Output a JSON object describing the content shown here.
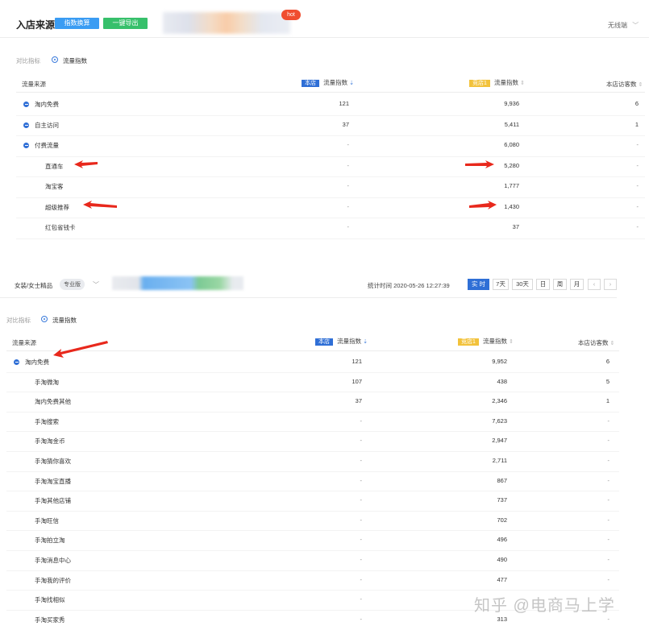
{
  "header": {
    "title": "入店来源",
    "index_button": "指数换算",
    "export_button": "一键导出",
    "hot_badge": "hot",
    "device_select": "无线端"
  },
  "panel1": {
    "compare_label": "对比指标",
    "compare_option": "流量指数",
    "col_source": "流量来源",
    "tag_own": "本店",
    "col_own": "流量指数",
    "tag_comp": "竞店1",
    "col_comp": "流量指数",
    "col_visitors": "本店访客数",
    "rows": [
      {
        "name": "淘内免费",
        "own": "121",
        "comp": "9,936",
        "visitors": "6"
      },
      {
        "name": "自主访问",
        "own": "37",
        "comp": "5,411",
        "visitors": "1"
      },
      {
        "name": "付费流量",
        "own": "-",
        "comp": "6,080",
        "visitors": "-"
      },
      {
        "name": "直通车",
        "own": "-",
        "comp": "5,280",
        "visitors": "-"
      },
      {
        "name": "淘宝客",
        "own": "-",
        "comp": "1,777",
        "visitors": "-"
      },
      {
        "name": "超级推荐",
        "own": "-",
        "comp": "1,430",
        "visitors": "-"
      },
      {
        "name": "红包省钱卡",
        "own": "-",
        "comp": "37",
        "visitors": "-"
      }
    ]
  },
  "toolbar2": {
    "category": "女装/女士精品",
    "edition": "专业版",
    "stat_time": "统计时间 2020-05-26 12:27:39",
    "periods": [
      "实 时",
      "7天",
      "30天",
      "日",
      "周",
      "月"
    ],
    "prev": "‹",
    "next": "›"
  },
  "panel2": {
    "compare_label": "对比指标",
    "compare_option": "流量指数",
    "col_source": "流量来源",
    "tag_own": "本店",
    "col_own": "流量指数",
    "tag_comp": "竞店1",
    "col_comp": "流量指数",
    "col_visitors": "本店访客数",
    "rows": [
      {
        "name": "淘内免费",
        "own": "121",
        "comp": "9,952",
        "visitors": "6"
      },
      {
        "name": "手淘微淘",
        "own": "107",
        "comp": "438",
        "visitors": "5"
      },
      {
        "name": "淘内免费其他",
        "own": "37",
        "comp": "2,346",
        "visitors": "1"
      },
      {
        "name": "手淘搜索",
        "own": "-",
        "comp": "7,623",
        "visitors": "-"
      },
      {
        "name": "手淘淘金币",
        "own": "-",
        "comp": "2,947",
        "visitors": "-"
      },
      {
        "name": "手淘猜你喜欢",
        "own": "-",
        "comp": "2,711",
        "visitors": "-"
      },
      {
        "name": "手淘淘宝直播",
        "own": "-",
        "comp": "867",
        "visitors": "-"
      },
      {
        "name": "手淘其他店铺",
        "own": "-",
        "comp": "737",
        "visitors": "-"
      },
      {
        "name": "手淘旺信",
        "own": "-",
        "comp": "702",
        "visitors": "-"
      },
      {
        "name": "手淘拍立淘",
        "own": "-",
        "comp": "496",
        "visitors": "-"
      },
      {
        "name": "手淘消息中心",
        "own": "-",
        "comp": "490",
        "visitors": "-"
      },
      {
        "name": "手淘我的评价",
        "own": "-",
        "comp": "477",
        "visitors": "-"
      },
      {
        "name": "手淘找相似",
        "own": "-",
        "comp": "",
        "visitors": "-"
      },
      {
        "name": "手淘买家秀",
        "own": "-",
        "comp": "313",
        "visitors": "-"
      }
    ]
  },
  "watermark": "知乎 @电商马上学",
  "colors": {
    "accent_blue": "#2f6fd6",
    "button_blue": "#3a9cf3",
    "button_green": "#37c06b",
    "tag_yellow": "#f2c23b",
    "hot_red": "#f04e30",
    "arrow_red": "#e8281c"
  }
}
